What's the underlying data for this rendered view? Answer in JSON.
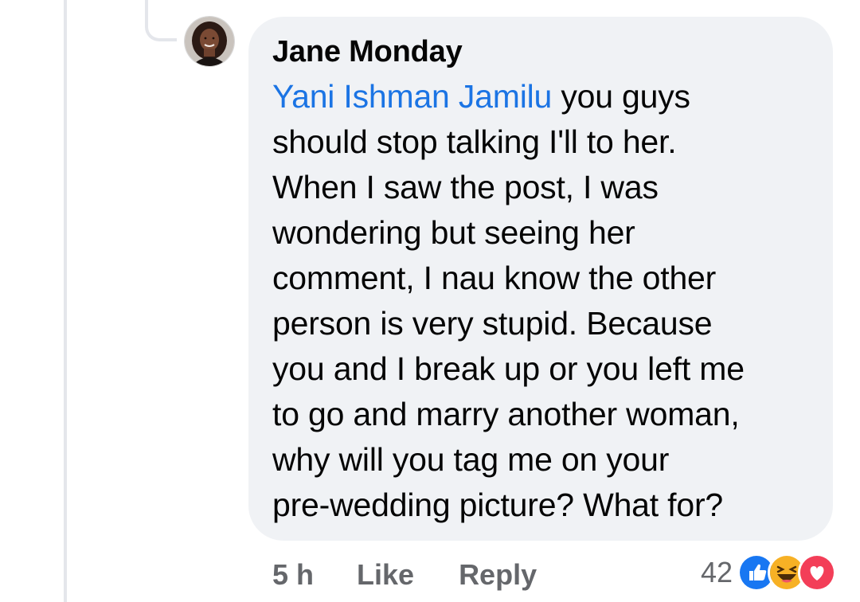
{
  "comment": {
    "author": "Jane Monday",
    "mention": "Yani Ishman Jamilu",
    "lines": [
      " you guys",
      "should stop talking I'll to her.",
      "When I saw the post, I was",
      "wondering but seeing her",
      "comment, I nau know the other",
      "person is very stupid. Because",
      "you and I break up or you left me",
      "to go and marry another woman,",
      "why will you tag me on your",
      "pre-wedding picture? What for?"
    ]
  },
  "actions": {
    "time": "5 h",
    "like_label": "Like",
    "reply_label": "Reply"
  },
  "reactions": {
    "count": "42",
    "icons": [
      "like-reaction-icon",
      "haha-reaction-icon",
      "love-reaction-icon"
    ]
  },
  "colors": {
    "bubble": "#f0f2f5",
    "mention": "#1b74e4",
    "secondary_text": "#65676b",
    "like_blue": "#1877f2",
    "love_red": "#f33e58",
    "haha_yellow": "#f7b125"
  }
}
